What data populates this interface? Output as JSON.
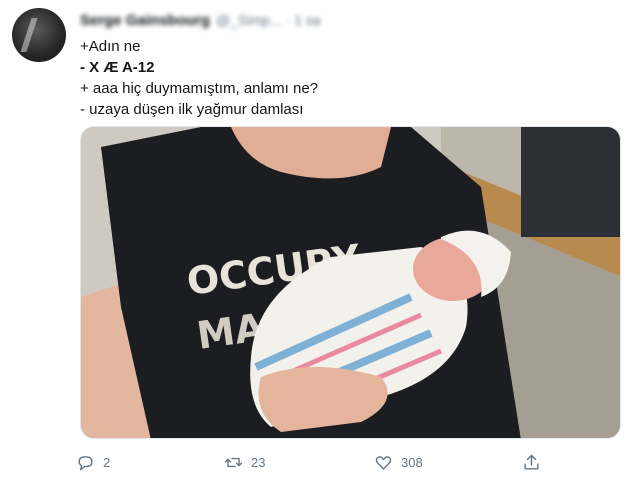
{
  "tweet": {
    "author_name": "Serge Gainsbourg",
    "author_handle": "@_Simp... · 1 sa",
    "lines": [
      "+Adın ne",
      "- X Æ A-12",
      "+ aaa hiç duymamıştım, anlamı ne?",
      "- uzaya düşen ilk yağmur damlası"
    ],
    "shirt_text_line1": "OCCUPY",
    "shirt_text_line2": "MARS",
    "actions": {
      "reply_count": "2",
      "retweet_count": "23",
      "like_count": "308"
    }
  },
  "icons": {
    "reply": "reply-icon",
    "retweet": "retweet-icon",
    "like": "heart-icon",
    "share": "share-icon"
  },
  "colors": {
    "text": "#14171a",
    "muted": "#657786",
    "shirt": "#1b1d21"
  }
}
